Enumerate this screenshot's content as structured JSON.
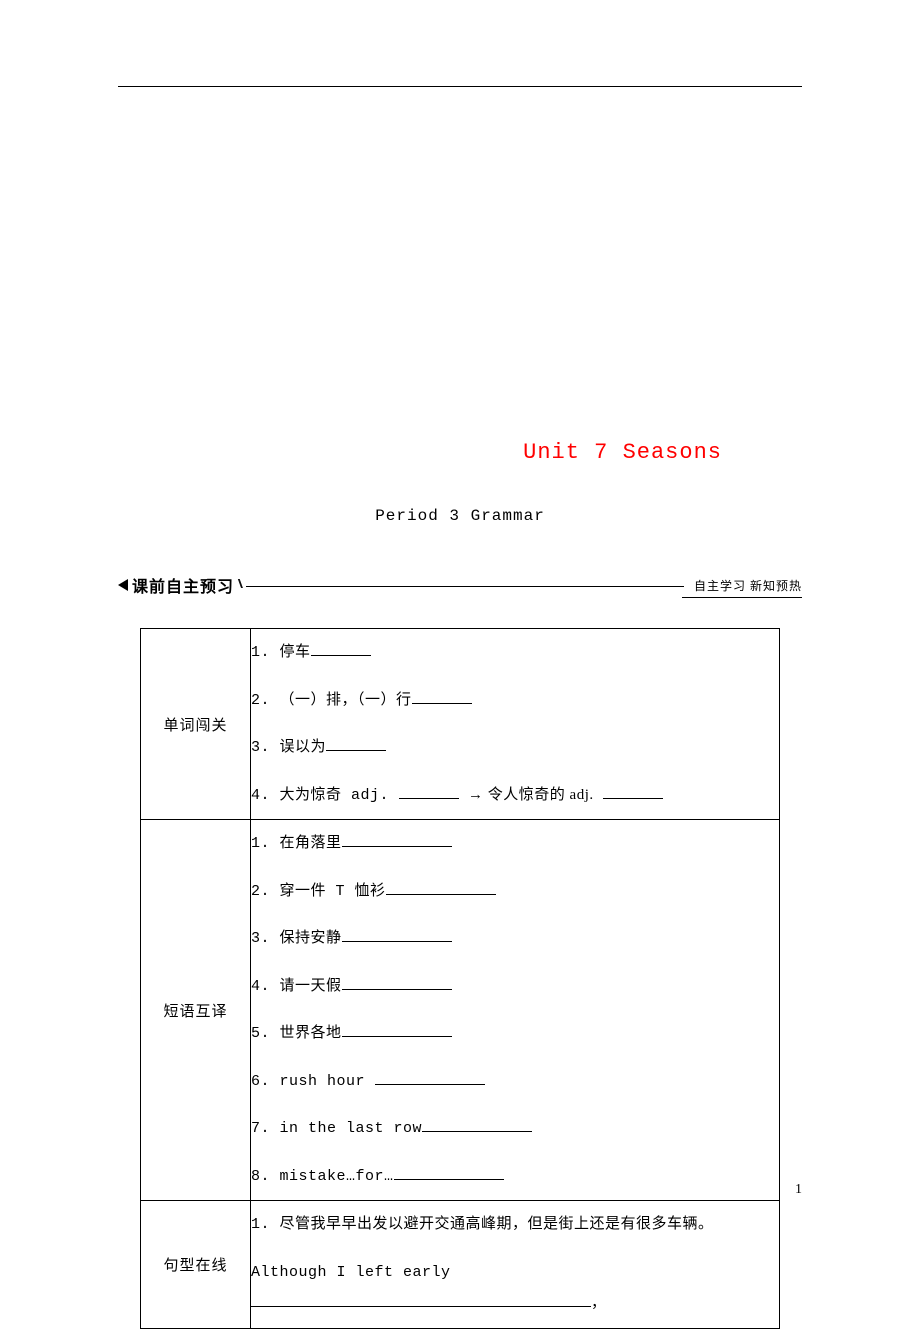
{
  "header": {
    "unit_title": "Unit 7 Seasons",
    "period_title": "Period 3  Grammar"
  },
  "section": {
    "heading": "课前自主预习",
    "right_text": "自主学习  新知预热"
  },
  "rows": {
    "vocab": {
      "label": "单词闯关",
      "items": [
        "1. 停车",
        "2. （一）排，（一）行",
        "3. 误以为",
        "4. 大为惊奇 adj."
      ],
      "item4_middle": "→ 令人惊奇的 adj."
    },
    "phrases": {
      "label": "短语互译",
      "items": [
        "1. 在角落里",
        "2. 穿一件 T 恤衫",
        "3. 保持安静",
        "4. 请一天假",
        "5. 世界各地",
        "6. rush hour",
        "7. in the last row",
        "8. mistake…for…"
      ]
    },
    "sentences": {
      "label": "句型在线",
      "item1_cn": "1. 尽管我早早出发以避开交通高峰期，但是街上还是有很多车辆。",
      "item1_en_prefix": "Although I left early",
      "item1_en_suffix": "，"
    }
  },
  "page_num": "1"
}
